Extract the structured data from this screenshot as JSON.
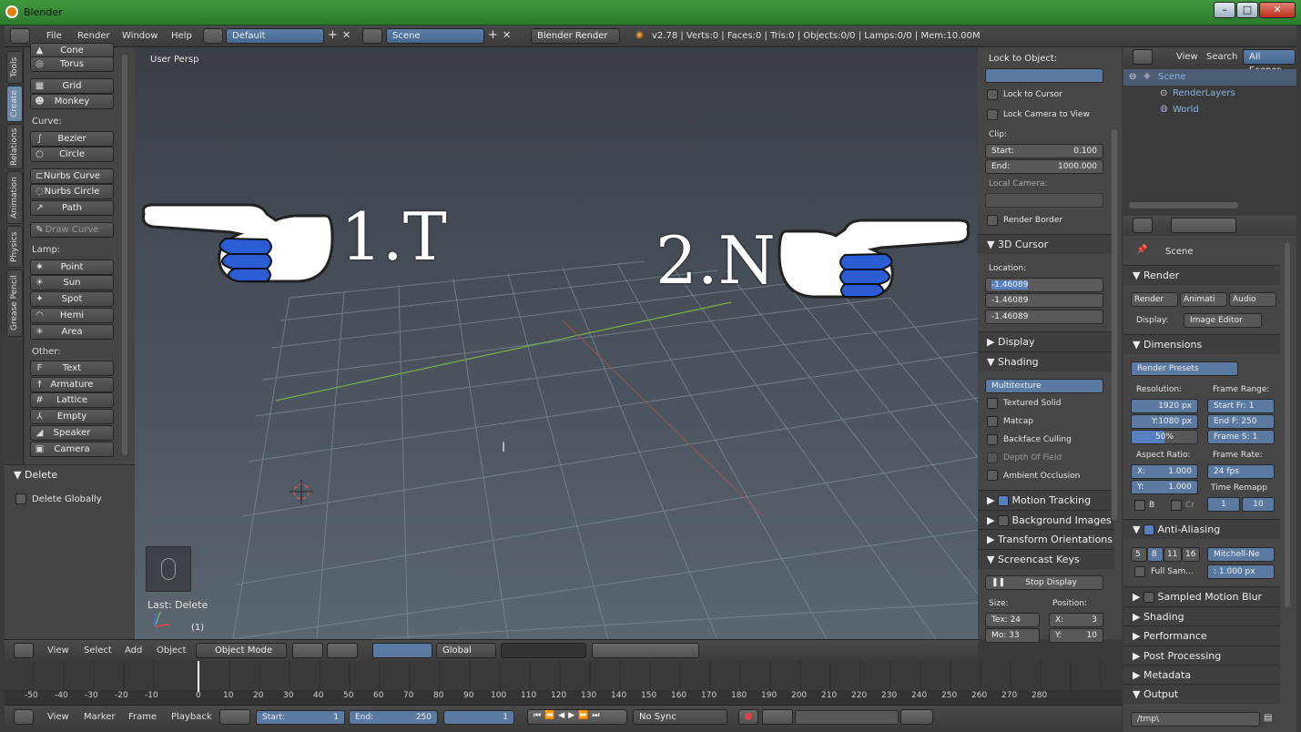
{
  "window": {
    "title": "Blender",
    "minimize": "–",
    "maximize": "□",
    "close": "✕"
  },
  "infobar": {
    "menus": [
      "File",
      "Render",
      "Window",
      "Help"
    ],
    "layout": "Default",
    "scene": "Scene",
    "engine": "Blender Render",
    "stats": "v2.78 | Verts:0 | Faces:0 | Tris:0 | Objects:0/0 | Lamps:0/0 | Mem:10.00M"
  },
  "tabs": [
    "Tools",
    "Create",
    "Relations",
    "Animation",
    "Physics",
    "Grease Pencil"
  ],
  "toolshelf": {
    "items_top": [
      "Cone",
      "Torus",
      "Grid",
      "Monkey"
    ],
    "curve_label": "Curve:",
    "curves": [
      "Bezier",
      "Circle",
      "Nurbs Curve",
      "Nurbs Circle",
      "Path"
    ],
    "draw_curve": "Draw Curve",
    "lamp_label": "Lamp:",
    "lamps": [
      "Point",
      "Sun",
      "Spot",
      "Hemi",
      "Area"
    ],
    "other_label": "Other:",
    "others": [
      "Text",
      "Armature",
      "Lattice",
      "Empty",
      "Speaker",
      "Camera"
    ]
  },
  "delete_panel": {
    "title": "Delete",
    "option": "Delete Globally"
  },
  "viewport": {
    "label": "User Persp",
    "last_op": "Last: Delete",
    "frame": "(1)",
    "overlay_left": "1.T",
    "overlay_right": "2.N"
  },
  "vp_header": {
    "menus": [
      "View",
      "Select",
      "Add",
      "Object"
    ],
    "mode": "Object Mode",
    "orientation": "Global"
  },
  "npanel": {
    "lock_to_object": "Lock to Object:",
    "lock_to_cursor": "Lock to Cursor",
    "lock_camera": "Lock Camera to View",
    "clip": "Clip:",
    "clip_start_label": "Start:",
    "clip_start": "0.100",
    "clip_end_label": "End:",
    "clip_end": "1000.000",
    "local_camera": "Local Camera:",
    "render_border": "Render Border",
    "cursor_section": "3D Cursor",
    "location": "Location:",
    "loc": [
      "-1.46089",
      "-1.46089",
      "-1.46089"
    ],
    "display": "Display",
    "shading": "Shading",
    "shading_mode": "Multitexture",
    "shading_opts": [
      "Textured Solid",
      "Matcap",
      "Backface Culling",
      "Depth Of Field",
      "Ambient Occlusion"
    ],
    "motion_tracking": "Motion Tracking",
    "background_images": "Background Images",
    "transform_orient": "Transform Orientations",
    "screencast": "Screencast Keys",
    "stop_display": "Stop Display",
    "size_label": "Size:",
    "position_label": "Position:",
    "tex": "Tex: 24",
    "mo": "Mo: 33",
    "pos_x": "X:",
    "pos_x_val": "3",
    "pos_y": "Y:",
    "pos_y_val": "10"
  },
  "outliner": {
    "view": "View",
    "search": "Search",
    "all_scenes": "All Scenes",
    "scene": "Scene",
    "renderlayers": "RenderLayers",
    "world": "World"
  },
  "properties": {
    "context": "Scene",
    "render": "Render",
    "tab_render": "Render",
    "tab_anim": "Animati",
    "tab_audio": "Audio",
    "display_label": "Display:",
    "display_val": "Image Editor",
    "dimensions": "Dimensions",
    "presets": "Render Presets",
    "resolution": "Resolution:",
    "frame_range": "Frame Range:",
    "res_x": "1920 px",
    "res_y": "Y:1080 px",
    "res_pct": "50%",
    "start_f": "Start Fr:  1",
    "end_f": "End F: 250",
    "frame_s": "Frame S: 1",
    "aspect": "Aspect Ratio:",
    "frame_rate": "Frame Rate:",
    "asp_x": "X:",
    "asp_x_val": "1.000",
    "asp_y": "Y:",
    "asp_y_val": "1.000",
    "fps": "24 fps",
    "time_remap": "Time Remapp",
    "b": "B",
    "cr": "Cr",
    "remap_1": "1",
    "remap_2": "10",
    "anti_aliasing": "Anti-Aliasing",
    "aa_samples": [
      "5",
      "8",
      "11",
      "16"
    ],
    "aa_filter": "Mitchell-Ne",
    "full_sample": "Full Sam...",
    "aa_size": ": 1.000 px",
    "sampled_motion": "Sampled Motion Blur",
    "shading": "Shading",
    "performance": "Performance",
    "post_processing": "Post Processing",
    "metadata": "Metadata",
    "output": "Output",
    "output_path": "/tmp\\"
  },
  "timeline": {
    "ticks": [
      "-50",
      "-40",
      "-30",
      "-20",
      "-10",
      "0",
      "10",
      "20",
      "30",
      "40",
      "50",
      "60",
      "70",
      "80",
      "90",
      "100",
      "110",
      "120",
      "130",
      "140",
      "150",
      "160",
      "170",
      "180",
      "190",
      "200",
      "210",
      "220",
      "230",
      "240",
      "250",
      "260",
      "270",
      "280"
    ],
    "menus": [
      "View",
      "Marker",
      "Frame",
      "Playback"
    ],
    "start_label": "Start:",
    "start": "1",
    "end_label": "End:",
    "end": "250",
    "current": "1",
    "sync": "No Sync"
  }
}
